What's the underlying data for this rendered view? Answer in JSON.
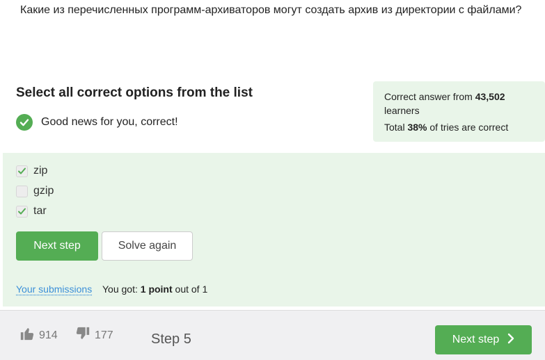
{
  "question": {
    "text": "Какие из перечисленных программ-архиваторов могут создать архив из директории с файлами?"
  },
  "result": {
    "title": "Select all correct options from the list",
    "message": "Good news for you, correct!"
  },
  "stats": {
    "prefix": "Correct answer from",
    "learners_count": "43,502",
    "learners_label": "learners",
    "total_prefix": "Total",
    "percent": "38%",
    "total_suffix": "of tries are correct"
  },
  "options": [
    {
      "label": "zip",
      "checked": true
    },
    {
      "label": "gzip",
      "checked": false
    },
    {
      "label": "tar",
      "checked": true
    }
  ],
  "actions": {
    "next_label": "Next step",
    "solve_again_label": "Solve again"
  },
  "submission": {
    "link_label": "Your submissions",
    "score_prefix": "You got:",
    "score_points": "1 point",
    "score_suffix": "out of 1"
  },
  "footer": {
    "likes": "914",
    "dislikes": "177",
    "step_word": "Step",
    "step_number": "5",
    "next_label": "Next step"
  },
  "colors": {
    "accent_green": "#54ad54",
    "panel_green": "#e9f5e9",
    "link_blue": "#3b8fd8"
  },
  "icons": {
    "success": "check-circle-icon",
    "like": "thumbs-up-icon",
    "dislike": "thumbs-down-icon",
    "next": "chevron-right-icon"
  }
}
